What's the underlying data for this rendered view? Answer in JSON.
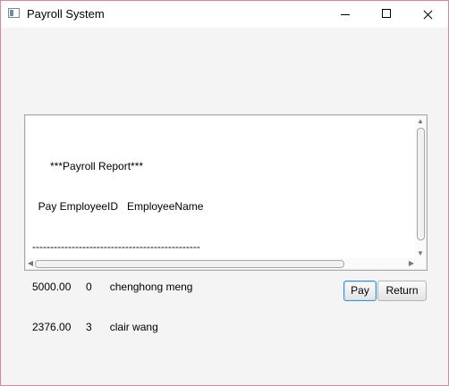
{
  "window": {
    "title": "Payroll System",
    "controls": [
      "minimize",
      "maximize",
      "close"
    ]
  },
  "report": {
    "lines": [
      "      ***Payroll Report***",
      "  Pay EmployeeID   EmployeeName",
      "-----------------------------------------------",
      "5000.00     0      chenghong meng",
      "2376.00     3      clair wang"
    ]
  },
  "buttons": {
    "pay_label": "Pay",
    "return_label": "Return"
  },
  "colors": {
    "focus_border": "#3a8fd6",
    "window_border": "#e08595",
    "background": "#f4f4f4"
  }
}
